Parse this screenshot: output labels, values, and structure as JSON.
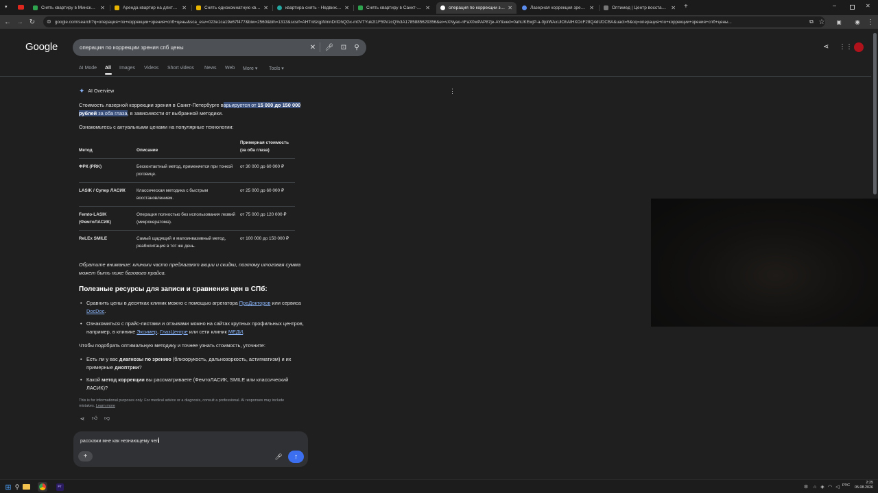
{
  "browser": {
    "tabs": [
      {
        "title": "Снять квартиру в Минске на...",
        "favicon": "green-cross-icon",
        "color": "#2ea44f"
      },
      {
        "title": "Аренда квартир на длительн...",
        "favicon": "yellow-square-icon",
        "color": "#e8b400"
      },
      {
        "title": "Снять однокомнатную кварти...",
        "favicon": "yellow-square-icon",
        "color": "#e8b400"
      },
      {
        "title": "квартира снять - Недвижимо...",
        "favicon": "teal-leaf-icon",
        "color": "#23a7a0"
      },
      {
        "title": "Снять квартиру в Санкт-Петер...",
        "favicon": "green-cross-icon",
        "color": "#2ea44f"
      },
      {
        "title": "операция по коррекции зрен...",
        "favicon": "google-g-icon",
        "color": "#8ab4f8"
      },
      {
        "title": "Лазерная коррекция зрения ...",
        "favicon": "eye-icon",
        "color": "#5b8def"
      },
      {
        "title": "Оптимед | Центр восстановле...",
        "favicon": "blank-page-icon",
        "color": "#bbbbbb"
      }
    ],
    "url": "google.com/search?q=операция+по+коррекции+зрения+спб+цены&sca_esv=023e1ca19e67f477&biw=2560&bih=1313&sxsrf=AHTn8zqpNmnDrIDhQGx-m0VTYuk2t1F59VzcQ%3A1785885629356&ei=vXNyao-nFaX0wPAP87je-AY&ved=0ahUKEwjP-a-0joiWAxUlOhAIHXOcF28Q4dUDCBA&uact=5&oq=операция+по+коррекции+зрения+спб+цены..."
  },
  "google": {
    "logo": "Google",
    "query": "операция по коррекции зрения спб цены",
    "tabs": [
      "AI Mode",
      "All",
      "Images",
      "Videos",
      "Short videos",
      "News",
      "Web",
      "More ▾",
      "Tools ▾"
    ]
  },
  "ai": {
    "label": "AI Overview",
    "intro_pre": "Стоимость лазерной коррекции зрения в Санкт-Петербурге в",
    "intro_hl_a": "арьируется от ",
    "intro_hl_b": "15 000 до 150 000 рублей",
    "intro_hl_c": " за оба глаза",
    "intro_post": ", в зависимости от выбранной методики.",
    "lead": "Ознакомьтесь с актуальными ценами на популярные технологии:",
    "table": {
      "headers": [
        "Метод",
        "Описание",
        "Примерная стоимость (за оба глаза)"
      ],
      "rows": [
        [
          "ФРК (PRK)",
          "Бесконтактный метод, применяется при тонкой роговице.",
          "от 30 000 до 60 000 ₽"
        ],
        [
          "LASIK / Супер ЛАСИК",
          "Классическая методика с быстрым восстановлением.",
          "от 25 000 до 60 000 ₽"
        ],
        [
          "Femto-LASIK (ФемтоЛАСИК)",
          "Операция полностью без использования лезвий (микрокератома).",
          "от 75 000 до 120 000 ₽"
        ],
        [
          "ReLEx SMILE",
          "Самый щадящий и малоинвазивный метод, реабилитация в тот же день.",
          "от 100 000 до 150 000 ₽"
        ]
      ]
    },
    "note": "Обратите внимание: клиники часто предлагают акции и скидки, поэтому итоговая сумма может быть ниже базового прайса.",
    "resources_title": "Полезные ресурсы для записи и сравнения цен в СПб:",
    "res1_pre": "Сравнить цены в десятках клиник можно с помощью агрегатора ",
    "res1_l1": "ПроДокторов",
    "res1_mid": " или сервиса ",
    "res1_l2": "DocDoc",
    "res1_post": ".",
    "res2_pre": "Ознакомиться с прайс-листами и отзывами можно на сайтах крупных профильных центров, например, в клинике ",
    "res2_l1": "Эксимер",
    "res2_c": ", ",
    "res2_l2": "ГлазЦентре",
    "res2_mid": " или сети клиник ",
    "res2_l3": "МЕДИ",
    "res2_post": ".",
    "clarify": "Чтобы подобрать оптимальную методику и точнее узнать стоимость, уточните:",
    "q1_pre": "Есть ли у вас ",
    "q1_b1": "диагнозы по зрению",
    "q1_mid": " (близорукость, дальнозоркость, астигматизм) и их примерные ",
    "q1_b2": "диоптрии",
    "q1_post": "?",
    "q2_pre": "Какой ",
    "q2_b": "метод коррекции",
    "q2_post": " вы рассматриваете (ФемтоЛАСИК, SMILE или классический ЛАСИК)?",
    "disclaimer": "This is for informational purposes only. For medical advice or a diagnosis, consult a professional. AI responses may include mistakes. ",
    "learn_more": "Learn more"
  },
  "followup": {
    "value": "расскажи мне как незнающему чел"
  },
  "taskbar": {
    "lang": "РУС",
    "time": "2:25",
    "date": "05.08.2026"
  },
  "colors": {
    "accent": "#8ab4f8",
    "send_button": "#3b6ff0",
    "highlight": "#394f7a"
  }
}
